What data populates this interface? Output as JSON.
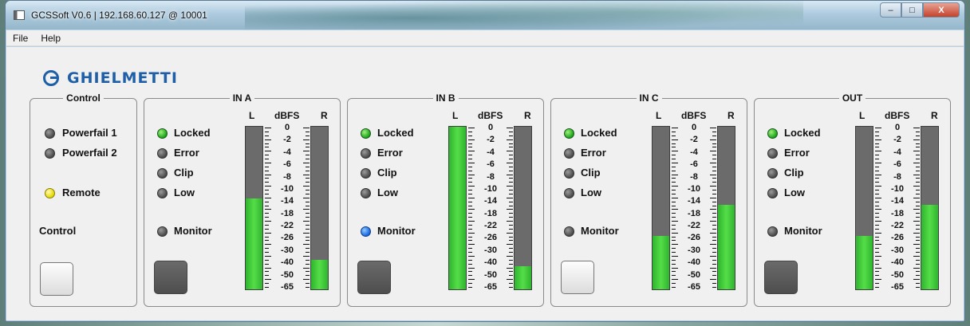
{
  "window": {
    "title": "GCSSoft V0.6 | 192.168.60.127 @ 10001"
  },
  "window_buttons": {
    "minimize": "–",
    "maximize": "□",
    "close": "X"
  },
  "menu": [
    "File",
    "Help"
  ],
  "logo": {
    "text": "GHIELMETTI"
  },
  "control_panel": {
    "title": "Control",
    "indicators": [
      {
        "label": "Powerfail 1",
        "state": "off",
        "color": "#5a5a5a"
      },
      {
        "label": "Powerfail 2",
        "state": "off",
        "color": "#5a5a5a"
      },
      {
        "label": "Remote",
        "state": "on",
        "color": "#e4d600"
      }
    ],
    "control_label": "Control",
    "control_button": "light"
  },
  "meter_header": {
    "left": "L",
    "unit": "dBFS",
    "right": "R"
  },
  "scale_labels": [
    "0",
    "-2",
    "-4",
    "-6",
    "-8",
    "-10",
    "-14",
    "-18",
    "-22",
    "-26",
    "-30",
    "-40",
    "-50",
    "-65"
  ],
  "channels": [
    {
      "title": "IN A",
      "indicators": [
        {
          "label": "Locked",
          "state": "on",
          "color": "#19a319"
        },
        {
          "label": "Error",
          "state": "off"
        },
        {
          "label": "Clip",
          "state": "off"
        },
        {
          "label": "Low",
          "state": "off"
        },
        {
          "label": "Monitor",
          "state": "off"
        }
      ],
      "button": "dark",
      "level_l": 0.56,
      "level_r": 0.18
    },
    {
      "title": "IN B",
      "indicators": [
        {
          "label": "Locked",
          "state": "on",
          "color": "#19a319"
        },
        {
          "label": "Error",
          "state": "off"
        },
        {
          "label": "Clip",
          "state": "off"
        },
        {
          "label": "Low",
          "state": "off"
        },
        {
          "label": "Monitor",
          "state": "on",
          "color": "#1765e0"
        }
      ],
      "button": "dark",
      "level_l": 1.0,
      "level_r": 0.14
    },
    {
      "title": "IN C",
      "indicators": [
        {
          "label": "Locked",
          "state": "on",
          "color": "#19a319"
        },
        {
          "label": "Error",
          "state": "off"
        },
        {
          "label": "Clip",
          "state": "off"
        },
        {
          "label": "Low",
          "state": "off"
        },
        {
          "label": "Monitor",
          "state": "off"
        }
      ],
      "button": "light",
      "level_l": 0.33,
      "level_r": 0.52
    },
    {
      "title": "OUT",
      "indicators": [
        {
          "label": "Locked",
          "state": "on",
          "color": "#19a319"
        },
        {
          "label": "Error",
          "state": "off"
        },
        {
          "label": "Clip",
          "state": "off"
        },
        {
          "label": "Low",
          "state": "off"
        },
        {
          "label": "Monitor",
          "state": "off"
        }
      ],
      "button": "dark",
      "level_l": 0.33,
      "level_r": 0.52
    }
  ]
}
